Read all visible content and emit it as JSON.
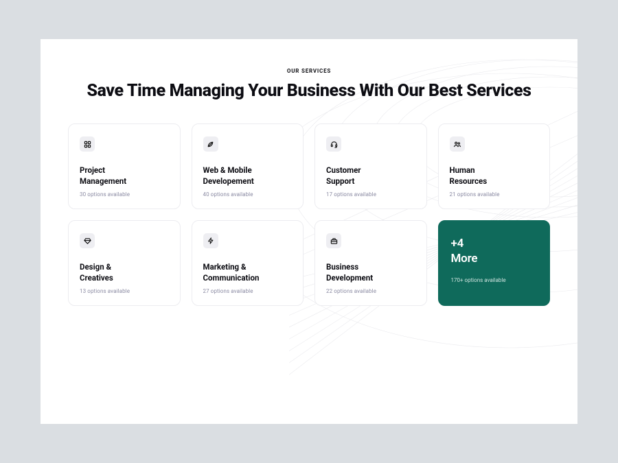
{
  "eyebrow": "OUR SERVICES",
  "headline": "Save Time Managing Your Business\nWith Our Best Services",
  "cards": [
    {
      "title": "Project\nManagement",
      "sub": "30 options available",
      "icon": "grid-icon"
    },
    {
      "title": "Web & Mobile\nDevelopement",
      "sub": "40 options available",
      "icon": "leaf-icon"
    },
    {
      "title": "Customer\nSupport",
      "sub": "17 options available",
      "icon": "headset-icon"
    },
    {
      "title": "Human\nResources",
      "sub": "21 options available",
      "icon": "users-icon"
    },
    {
      "title": "Design &\nCreatives",
      "sub": "13 options available",
      "icon": "diamond-icon"
    },
    {
      "title": "Marketing &\nCommunication",
      "sub": "27 options available",
      "icon": "bolt-icon"
    },
    {
      "title": "Business\nDevelopment",
      "sub": "22 options available",
      "icon": "briefcase-icon"
    }
  ],
  "more": {
    "title": "+4\nMore",
    "sub": "170+ options available"
  }
}
